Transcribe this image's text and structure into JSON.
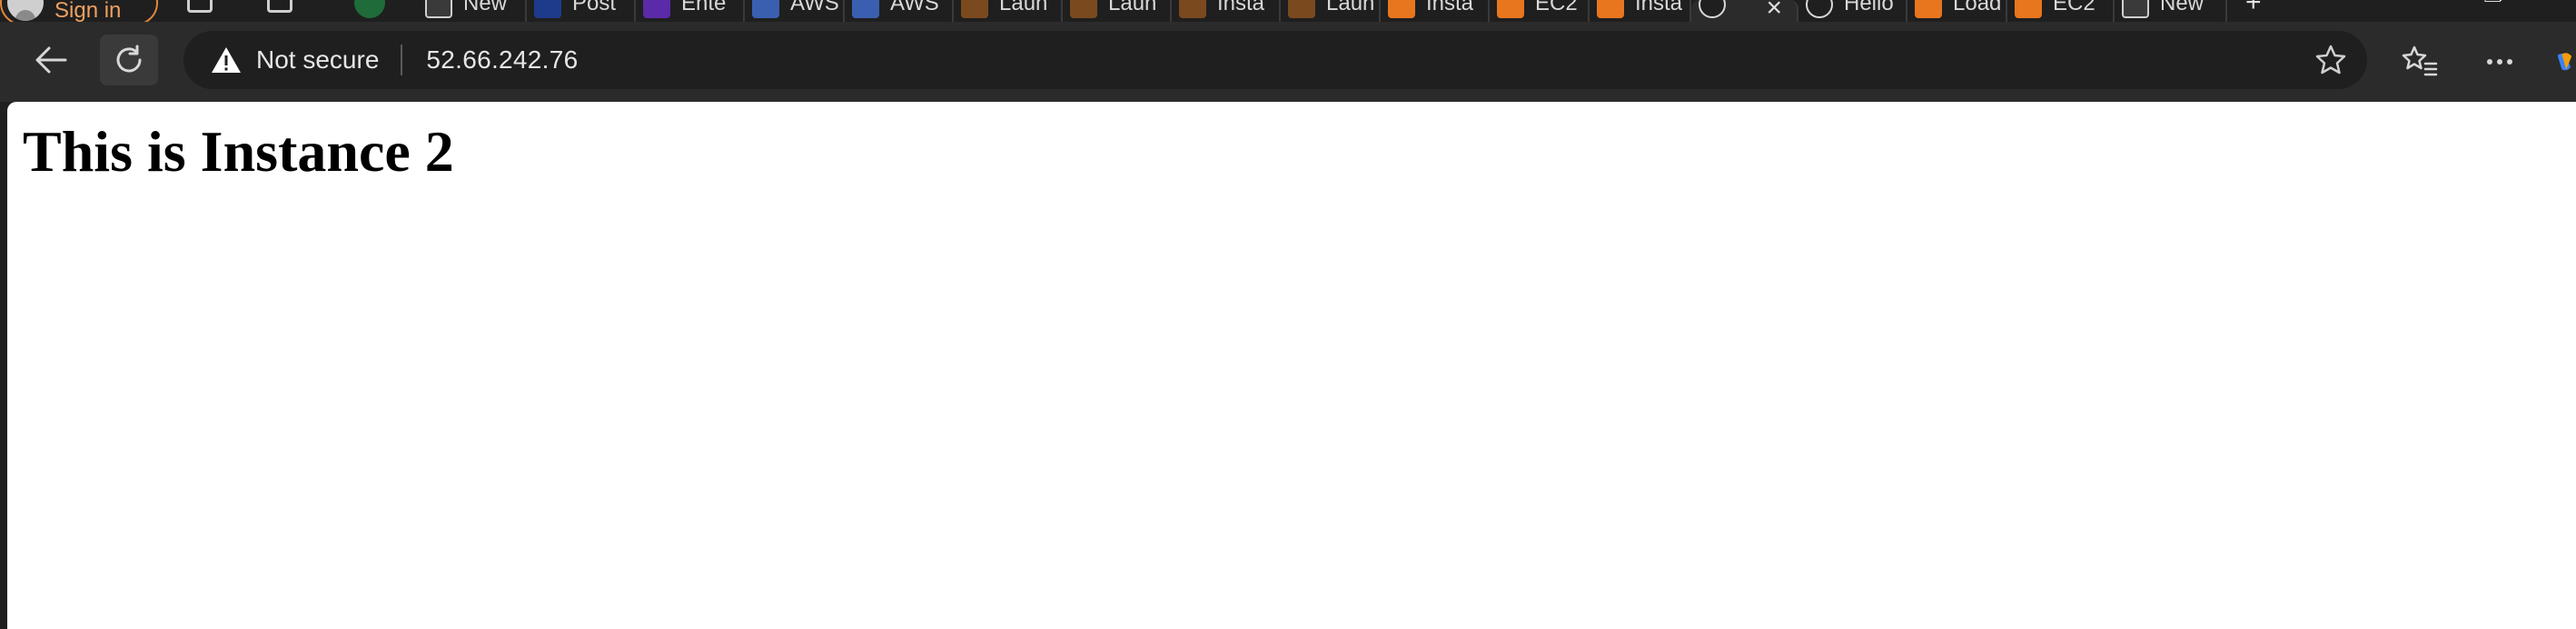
{
  "profile": {
    "label": "Sign in"
  },
  "tabs": [
    {
      "title": "New",
      "fav_color": "#3a3a3a",
      "fav_border": "#cfcfcf"
    },
    {
      "title": "Post",
      "fav_color": "#1e3a8a",
      "fav_border": "#1e3a8a"
    },
    {
      "title": "Ente",
      "fav_color": "#5b2aa8",
      "fav_border": "#5b2aa8"
    },
    {
      "title": "AWS",
      "fav_color": "#3b5fb0",
      "fav_border": "#3b5fb0"
    },
    {
      "title": "AWS",
      "fav_color": "#3b5fb0",
      "fav_border": "#3b5fb0"
    },
    {
      "title": "Laun",
      "fav_color": "#7a4a1e",
      "fav_border": "#7a4a1e"
    },
    {
      "title": "Laun",
      "fav_color": "#7a4a1e",
      "fav_border": "#7a4a1e"
    },
    {
      "title": "Insta",
      "fav_color": "#7a4a1e",
      "fav_border": "#7a4a1e"
    },
    {
      "title": "Laun",
      "fav_color": "#7a4a1e",
      "fav_border": "#7a4a1e"
    },
    {
      "title": "Insta",
      "fav_color": "#e8761e",
      "fav_border": "#e8761e"
    },
    {
      "title": "EC2",
      "fav_color": "#e8761e",
      "fav_border": "#e8761e"
    },
    {
      "title": "Insta",
      "fav_color": "#e8761e",
      "fav_border": "#e8761e"
    },
    {
      "title": "",
      "fav_color": "#1f1f1f",
      "fav_border": "#d8d8d8",
      "active": true
    },
    {
      "title": "Hello",
      "fav_color": "#1f1f1f",
      "fav_border": "#d8d8d8"
    },
    {
      "title": "Load",
      "fav_color": "#e8761e",
      "fav_border": "#e8761e"
    },
    {
      "title": "EC2",
      "fav_color": "#e8761e",
      "fav_border": "#e8761e"
    },
    {
      "title": "New",
      "fav_color": "#3a3a3a",
      "fav_border": "#cfcfcf"
    }
  ],
  "address_bar": {
    "security_label": "Not secure",
    "url": "52.66.242.76"
  },
  "page": {
    "heading": "This is Instance 2"
  },
  "colors": {
    "chrome_dark": "#1f1f1f",
    "toolbar": "#2b2b2b",
    "accent_orange": "#e0883a"
  }
}
